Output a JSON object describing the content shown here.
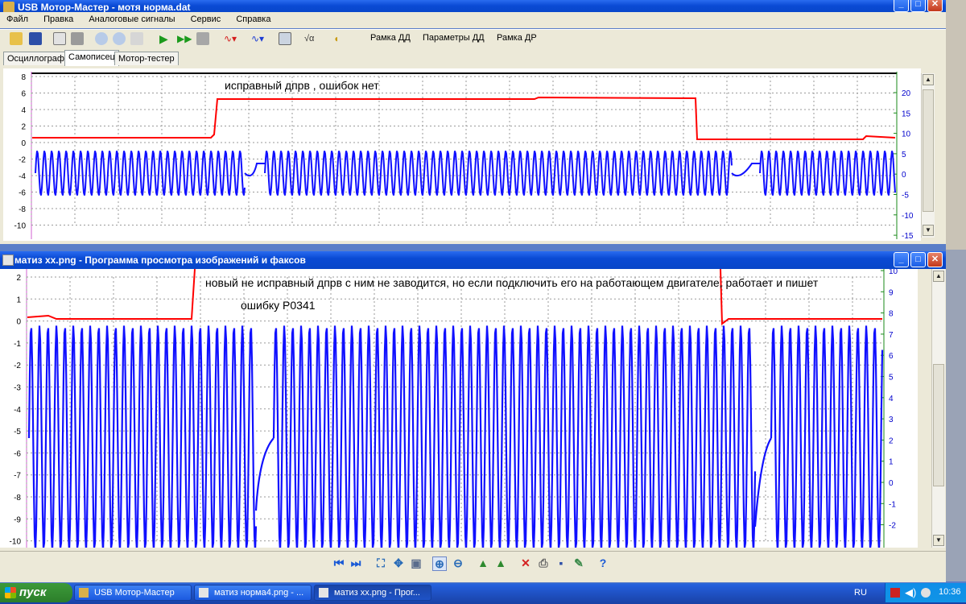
{
  "back_window": {
    "title": "USB Мотор-Мастер - мотя норма.dat",
    "menu": [
      "Файл",
      "Правка",
      "Аналоговые сигналы",
      "Сервис",
      "Справка"
    ],
    "toolbar_text_buttons": [
      "Рамка ДД",
      "Параметры ДД",
      "Рамка ДР"
    ],
    "tabs": [
      "Осциллограф",
      "Самописец",
      "Мотор-тестер"
    ],
    "active_tab": "Самописец",
    "annotation": "исправный дпрв , ошибок нет",
    "left_axis_ticks": [
      "8",
      "6",
      "4",
      "2",
      "0",
      "-2",
      "-4",
      "-6",
      "-8",
      "-10"
    ],
    "right_axis_ticks": [
      "20",
      "15",
      "10",
      "5",
      "0",
      "-5",
      "-10",
      "-15"
    ],
    "colors": {
      "red_trace": "#ff0000",
      "blue_trace": "#1010ff",
      "right_axis": "#0000cc"
    }
  },
  "front_window": {
    "title": "матиз хх.png - Программа просмотра изображений и факсов",
    "annotation_line1": "новый не исправный дпрв с ним не заводится, но если подключить его на работающем двигателе, работает и пишет",
    "annotation_line2": "ошибку P0341",
    "left_axis_ticks": [
      "2",
      "1",
      "0",
      "-1",
      "-2",
      "-3",
      "-4",
      "-5",
      "-6",
      "-7",
      "-8",
      "-9",
      "-10"
    ],
    "right_axis_ticks": [
      "10",
      "9",
      "8",
      "7",
      "6",
      "5",
      "4",
      "3",
      "2",
      "1",
      "0",
      "-1",
      "-2"
    ],
    "viewer_icons": [
      "prev-icon",
      "next-icon",
      "best-fit-icon",
      "actual-size-icon",
      "slideshow-icon",
      "zoom-in-icon",
      "zoom-out-icon",
      "rotate-cw-icon",
      "rotate-ccw-icon",
      "delete-icon",
      "print-icon",
      "save-icon",
      "edit-icon",
      "help-icon"
    ]
  },
  "taskbar": {
    "start_label": "пуск",
    "tasks": [
      "USB Мотор-Мастер",
      "матиз норма4.png - ...",
      "матиз хх.png - Прог..."
    ],
    "active_task": 2,
    "language": "RU",
    "clock": "10:36"
  }
}
